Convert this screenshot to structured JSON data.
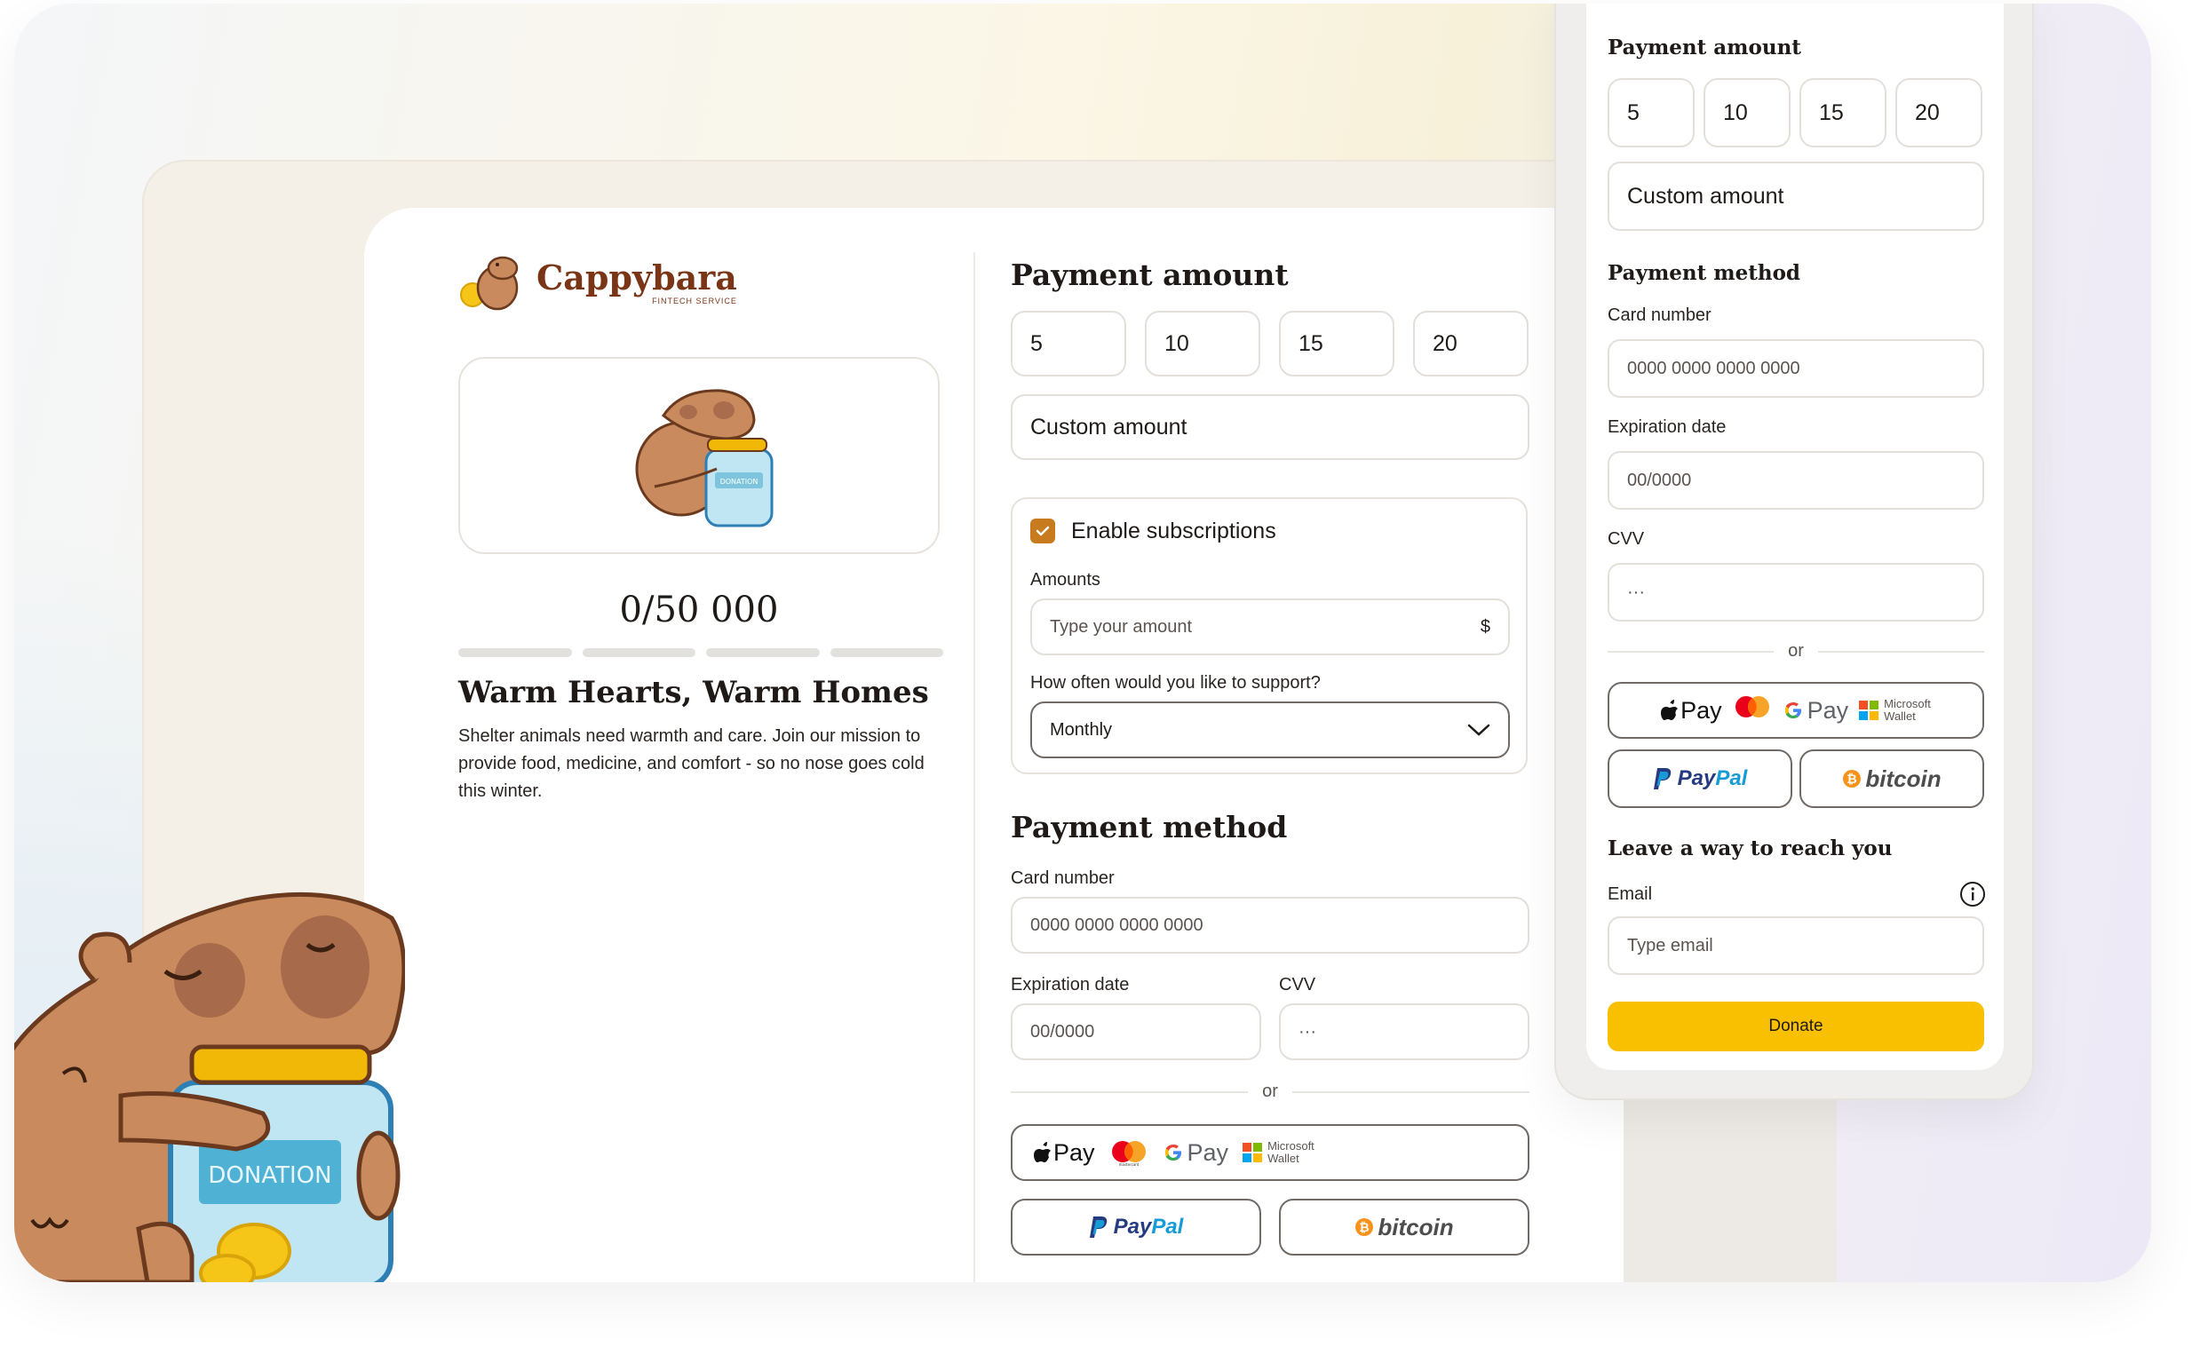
{
  "brand": {
    "name": "Cappybara",
    "tagline": "FINTECH SERVICE"
  },
  "campaign": {
    "goal_text": "0/50 000",
    "progress": 0,
    "title": "Warm Hearts, Warm Homes",
    "description": "Shelter animals need warmth and care. Join our mission to provide food, medicine, and comfort - so no nose goes cold this winter.",
    "jar_label": "DONATION"
  },
  "payment_amount": {
    "heading": "Payment amount",
    "options": [
      "5",
      "10",
      "15",
      "20"
    ],
    "custom_placeholder": "Custom amount"
  },
  "subscriptions": {
    "label": "Enable subscriptions",
    "checked": true,
    "amounts_label": "Amounts",
    "amount_placeholder": "Type your amount",
    "currency": "$",
    "frequency_label": "How often would you like to support?",
    "frequency_value": "Monthly"
  },
  "payment_method": {
    "heading": "Payment method",
    "card_label": "Card number",
    "card_placeholder": "0000 0000 0000 0000",
    "exp_label": "Expiration date",
    "exp_placeholder": "00/0000",
    "cvv_label": "CVV",
    "cvv_placeholder": "···",
    "or": "or",
    "wallets": {
      "apple": "Pay",
      "google": "Pay",
      "microsoft_line1": "Microsoft",
      "microsoft_line2": "Wallet",
      "mastercard": "mastercard"
    },
    "paypal": "PayPal",
    "bitcoin": "bitcoin"
  },
  "contact": {
    "heading": "Leave a way to reach you",
    "email_label": "Email",
    "email_placeholder": "Type email",
    "donate": "Donate"
  },
  "colors": {
    "accent": "#f8c000",
    "brand": "#7a3516",
    "checkbox": "#c77b1e",
    "capybara": "#c98a5e"
  }
}
